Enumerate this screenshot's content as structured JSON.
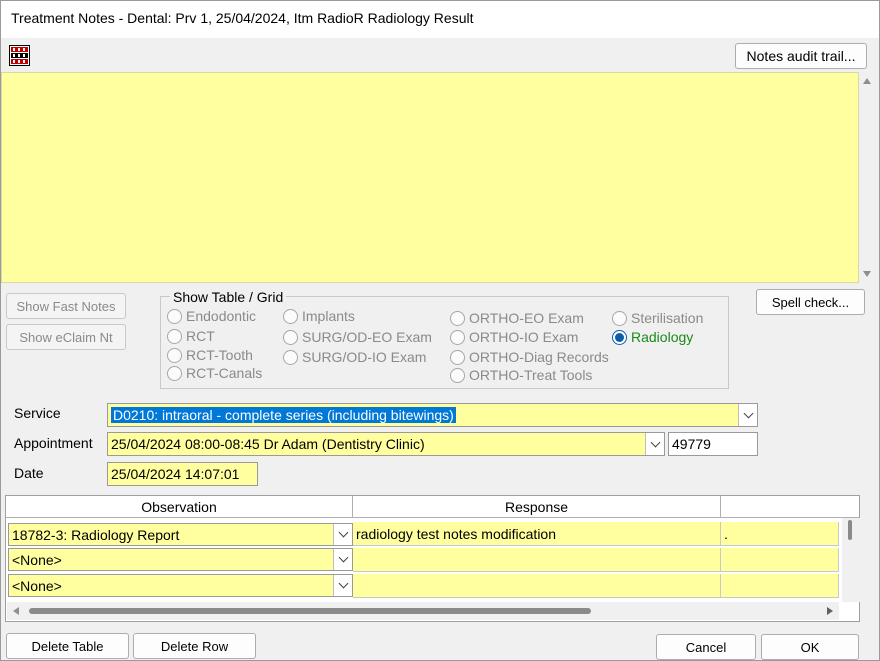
{
  "window": {
    "title": "Treatment Notes - Dental: Prv 1, 25/04/2024, Itm RadioR Radiology Result"
  },
  "toolbar": {
    "icon": "abc-spell-icon",
    "audit_label": "Notes audit trail..."
  },
  "notes": {
    "text": ""
  },
  "side_buttons": {
    "fast_notes": "Show Fast Notes",
    "eclaim": "Show eClaim Nt",
    "spell_check": "Spell check..."
  },
  "show_table": {
    "legend": "Show Table / Grid",
    "options": [
      "Endodontic",
      "RCT",
      "RCT-Tooth",
      "RCT-Canals",
      "Implants",
      "SURG/OD-EO Exam",
      "SURG/OD-IO Exam",
      "ORTHO-EO Exam",
      "ORTHO-IO Exam",
      "ORTHO-Diag Records",
      "ORTHO-Treat Tools",
      "Sterilisation",
      "Radiology"
    ],
    "selected": "Radiology"
  },
  "form": {
    "service_label": "Service",
    "service_value": "D0210: intraoral - complete series (including bitewings)",
    "appointment_label": "Appointment",
    "appointment_value": "25/04/2024 08:00-08:45 Dr Adam (Dentistry Clinic)",
    "appointment_id": "49779",
    "date_label": "Date",
    "date_value": "25/04/2024 14:07:01"
  },
  "grid": {
    "columns": [
      "Observation",
      "Response",
      ""
    ],
    "rows": [
      {
        "observation": "18782-3: Radiology Report",
        "response": "radiology test notes modification",
        "extra": "."
      },
      {
        "observation": "<None>",
        "response": "",
        "extra": ""
      },
      {
        "observation": "<None>",
        "response": "",
        "extra": ""
      }
    ]
  },
  "footer": {
    "delete_table": "Delete Table",
    "delete_row": "Delete Row",
    "cancel": "Cancel",
    "ok": "OK"
  },
  "colors": {
    "note_bg": "#ffff9f",
    "selection": "#0078d7",
    "radio_selected": "#1a8a1a"
  }
}
